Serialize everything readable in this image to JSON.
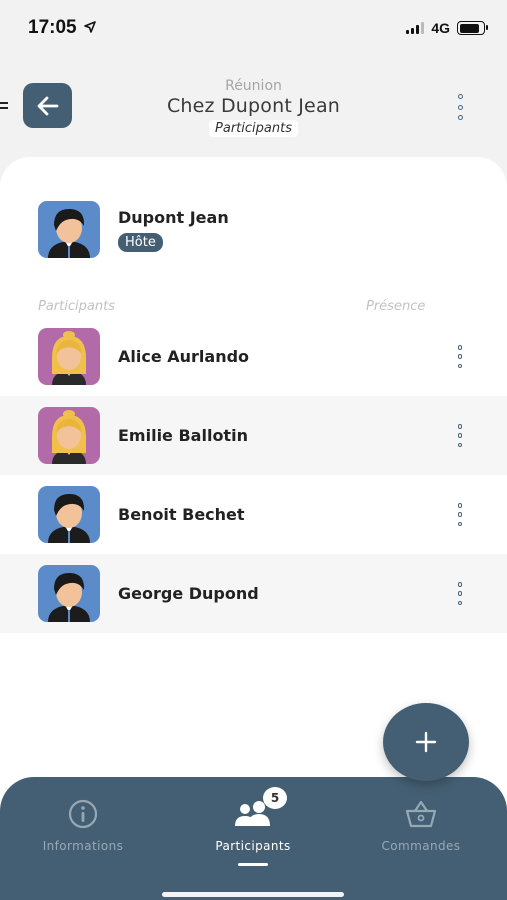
{
  "status_bar": {
    "time": "17:05",
    "network": "4G",
    "battery_level": 0.85
  },
  "header": {
    "subtitle": "Réunion",
    "title": "Chez Dupont Jean",
    "section": "Participants"
  },
  "host": {
    "name": "Dupont Jean",
    "badge": "Hôte",
    "avatar": "male-avatar"
  },
  "columns": {
    "left": "Participants",
    "right": "Présence"
  },
  "participants": [
    {
      "name": "Alice Aurlando",
      "avatar": "female-avatar"
    },
    {
      "name": "Emilie Ballotin",
      "avatar": "female-avatar"
    },
    {
      "name": "Benoit Bechet",
      "avatar": "male-avatar"
    },
    {
      "name": "George Dupond",
      "avatar": "male-avatar"
    }
  ],
  "fab": {
    "icon": "plus-icon"
  },
  "nav": {
    "items": [
      {
        "label": "Informations",
        "icon": "info-icon"
      },
      {
        "label": "Participants",
        "icon": "people-icon",
        "badge": "5",
        "active": true
      },
      {
        "label": "Commandes",
        "icon": "basket-icon"
      }
    ]
  },
  "colors": {
    "accent": "#445f73",
    "male_bg": "#5b8cc9",
    "female_bg": "#b26aa8"
  }
}
